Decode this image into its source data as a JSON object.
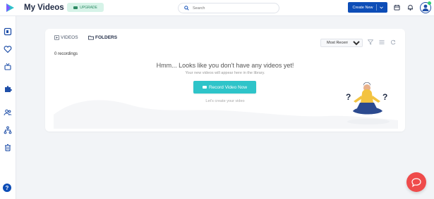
{
  "header": {
    "title": "My Videos",
    "upgrade_label": "UPGRADE",
    "search_placeholder": "Search",
    "create_label": "Create New"
  },
  "tabs": {
    "videos_label": "VIDEOS",
    "folders_label": "FOLDERS"
  },
  "toolbar": {
    "sort_selected": "Most Recent"
  },
  "content": {
    "recordings_count": "0 recordings",
    "empty_title": "Hmm... Looks like you don't have any videos yet!",
    "empty_subtitle": "Your new videos will appear here in the library.",
    "record_button_label": "Record Video Now",
    "hint": "Let's create your video"
  },
  "help": {
    "label": "?"
  },
  "colors": {
    "primary": "#0d4db7",
    "accent_teal": "#2ec4c9",
    "upgrade_bg": "#d6f3e8",
    "chat_red": "#ef4b4b"
  }
}
